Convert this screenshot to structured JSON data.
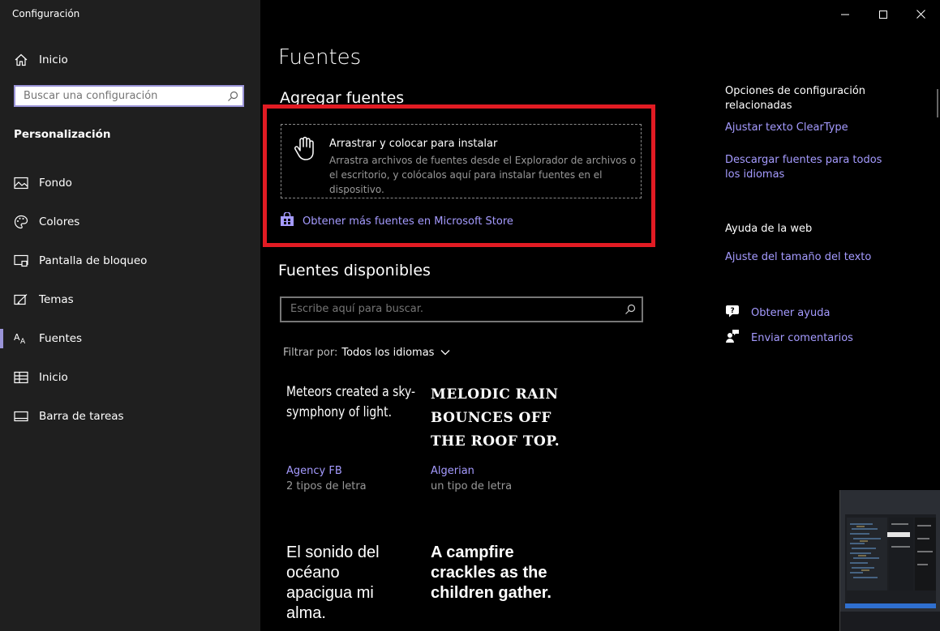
{
  "app": {
    "title": "Configuración"
  },
  "sidebar": {
    "home_label": "Inicio",
    "search_placeholder": "Buscar una configuración",
    "section": "Personalización",
    "items": [
      {
        "label": "Fondo",
        "icon": "picture-icon"
      },
      {
        "label": "Colores",
        "icon": "palette-icon"
      },
      {
        "label": "Pantalla de bloqueo",
        "icon": "lock-screen-icon"
      },
      {
        "label": "Temas",
        "icon": "themes-icon"
      },
      {
        "label": "Fuentes",
        "icon": "fonts-icon",
        "active": true
      },
      {
        "label": "Inicio",
        "icon": "start-icon"
      },
      {
        "label": "Barra de tareas",
        "icon": "taskbar-icon"
      }
    ]
  },
  "main": {
    "title": "Fuentes",
    "add_fonts_heading": "Agregar fuentes",
    "dropzone": {
      "title": "Arrastrar y colocar para instalar",
      "description": "Arrastra archivos de fuentes desde el Explorador de archivos o el escritorio, y colócalos aquí para instalar fuentes en el dispositivo."
    },
    "store_link": "Obtener más fuentes en Microsoft Store",
    "available_heading": "Fuentes disponibles",
    "search_placeholder": "Escribe aquí para buscar.",
    "filter_label": "Filtrar por:",
    "filter_value": "Todos los idiomas",
    "fonts": [
      {
        "sample": "Meteors created a sky-symphony of light.",
        "name": "Agency FB",
        "count": "2 tipos de letra"
      },
      {
        "sample": "MELODIC RAIN BOUNCES OFF THE ROOF TOP.",
        "name": "Algerian",
        "count": "un tipo de letra"
      },
      {
        "sample": "El sonido del océano apacigua mi alma."
      },
      {
        "sample": "A campfire crackles as the children gather."
      }
    ]
  },
  "related": {
    "heading": "Opciones de configuración relacionadas",
    "links": [
      "Ajustar texto ClearType",
      "Descargar fuentes para todos los idiomas"
    ],
    "web_help_heading": "Ayuda de la web",
    "web_help_link": "Ajuste del tamaño del texto",
    "get_help": "Obtener ayuda",
    "feedback": "Enviar comentarios"
  },
  "colors": {
    "accent": "#a59bff",
    "highlight": "#e21b23",
    "sidebar_bg": "#1f1f1f"
  }
}
